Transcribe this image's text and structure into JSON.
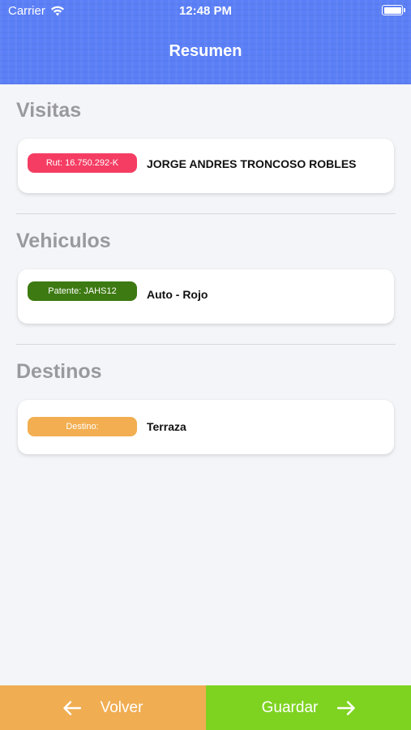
{
  "status_bar": {
    "carrier": "Carrier",
    "time": "12:48 PM",
    "wifi_icon": "wifi-icon",
    "battery_icon": "battery-icon"
  },
  "header": {
    "title": "Resumen",
    "color": "#5b7ff7"
  },
  "sections": {
    "visitas": {
      "title": "Visitas",
      "badge": "Rut: 16.750.292-K",
      "badge_color": "#f53d63",
      "text": "JORGE ANDRES TRONCOSO ROBLES"
    },
    "vehiculos": {
      "title": "Vehiculos",
      "badge": "Patente: JAHS12",
      "badge_color": "#3d7a12",
      "text": "Auto - Rojo"
    },
    "destinos": {
      "title": "Destinos",
      "badge": "Destino:",
      "badge_color": "#f2ae50",
      "text": "Terraza"
    }
  },
  "footer": {
    "back_label": "Volver",
    "back_icon": "arrow-left-icon",
    "back_color": "#f0ad52",
    "save_label": "Guardar",
    "save_icon": "arrow-right-icon",
    "save_color": "#7ed321"
  }
}
